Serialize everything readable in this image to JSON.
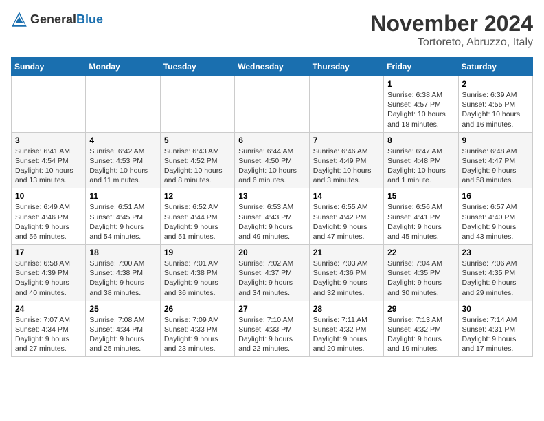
{
  "header": {
    "logo_general": "General",
    "logo_blue": "Blue",
    "month": "November 2024",
    "location": "Tortoreto, Abruzzo, Italy"
  },
  "weekdays": [
    "Sunday",
    "Monday",
    "Tuesday",
    "Wednesday",
    "Thursday",
    "Friday",
    "Saturday"
  ],
  "weeks": [
    [
      {
        "day": "",
        "sunrise": "",
        "sunset": "",
        "daylight": ""
      },
      {
        "day": "",
        "sunrise": "",
        "sunset": "",
        "daylight": ""
      },
      {
        "day": "",
        "sunrise": "",
        "sunset": "",
        "daylight": ""
      },
      {
        "day": "",
        "sunrise": "",
        "sunset": "",
        "daylight": ""
      },
      {
        "day": "",
        "sunrise": "",
        "sunset": "",
        "daylight": ""
      },
      {
        "day": "1",
        "sunrise": "Sunrise: 6:38 AM",
        "sunset": "Sunset: 4:57 PM",
        "daylight": "Daylight: 10 hours and 18 minutes."
      },
      {
        "day": "2",
        "sunrise": "Sunrise: 6:39 AM",
        "sunset": "Sunset: 4:55 PM",
        "daylight": "Daylight: 10 hours and 16 minutes."
      }
    ],
    [
      {
        "day": "3",
        "sunrise": "Sunrise: 6:41 AM",
        "sunset": "Sunset: 4:54 PM",
        "daylight": "Daylight: 10 hours and 13 minutes."
      },
      {
        "day": "4",
        "sunrise": "Sunrise: 6:42 AM",
        "sunset": "Sunset: 4:53 PM",
        "daylight": "Daylight: 10 hours and 11 minutes."
      },
      {
        "day": "5",
        "sunrise": "Sunrise: 6:43 AM",
        "sunset": "Sunset: 4:52 PM",
        "daylight": "Daylight: 10 hours and 8 minutes."
      },
      {
        "day": "6",
        "sunrise": "Sunrise: 6:44 AM",
        "sunset": "Sunset: 4:50 PM",
        "daylight": "Daylight: 10 hours and 6 minutes."
      },
      {
        "day": "7",
        "sunrise": "Sunrise: 6:46 AM",
        "sunset": "Sunset: 4:49 PM",
        "daylight": "Daylight: 10 hours and 3 minutes."
      },
      {
        "day": "8",
        "sunrise": "Sunrise: 6:47 AM",
        "sunset": "Sunset: 4:48 PM",
        "daylight": "Daylight: 10 hours and 1 minute."
      },
      {
        "day": "9",
        "sunrise": "Sunrise: 6:48 AM",
        "sunset": "Sunset: 4:47 PM",
        "daylight": "Daylight: 9 hours and 58 minutes."
      }
    ],
    [
      {
        "day": "10",
        "sunrise": "Sunrise: 6:49 AM",
        "sunset": "Sunset: 4:46 PM",
        "daylight": "Daylight: 9 hours and 56 minutes."
      },
      {
        "day": "11",
        "sunrise": "Sunrise: 6:51 AM",
        "sunset": "Sunset: 4:45 PM",
        "daylight": "Daylight: 9 hours and 54 minutes."
      },
      {
        "day": "12",
        "sunrise": "Sunrise: 6:52 AM",
        "sunset": "Sunset: 4:44 PM",
        "daylight": "Daylight: 9 hours and 51 minutes."
      },
      {
        "day": "13",
        "sunrise": "Sunrise: 6:53 AM",
        "sunset": "Sunset: 4:43 PM",
        "daylight": "Daylight: 9 hours and 49 minutes."
      },
      {
        "day": "14",
        "sunrise": "Sunrise: 6:55 AM",
        "sunset": "Sunset: 4:42 PM",
        "daylight": "Daylight: 9 hours and 47 minutes."
      },
      {
        "day": "15",
        "sunrise": "Sunrise: 6:56 AM",
        "sunset": "Sunset: 4:41 PM",
        "daylight": "Daylight: 9 hours and 45 minutes."
      },
      {
        "day": "16",
        "sunrise": "Sunrise: 6:57 AM",
        "sunset": "Sunset: 4:40 PM",
        "daylight": "Daylight: 9 hours and 43 minutes."
      }
    ],
    [
      {
        "day": "17",
        "sunrise": "Sunrise: 6:58 AM",
        "sunset": "Sunset: 4:39 PM",
        "daylight": "Daylight: 9 hours and 40 minutes."
      },
      {
        "day": "18",
        "sunrise": "Sunrise: 7:00 AM",
        "sunset": "Sunset: 4:38 PM",
        "daylight": "Daylight: 9 hours and 38 minutes."
      },
      {
        "day": "19",
        "sunrise": "Sunrise: 7:01 AM",
        "sunset": "Sunset: 4:38 PM",
        "daylight": "Daylight: 9 hours and 36 minutes."
      },
      {
        "day": "20",
        "sunrise": "Sunrise: 7:02 AM",
        "sunset": "Sunset: 4:37 PM",
        "daylight": "Daylight: 9 hours and 34 minutes."
      },
      {
        "day": "21",
        "sunrise": "Sunrise: 7:03 AM",
        "sunset": "Sunset: 4:36 PM",
        "daylight": "Daylight: 9 hours and 32 minutes."
      },
      {
        "day": "22",
        "sunrise": "Sunrise: 7:04 AM",
        "sunset": "Sunset: 4:35 PM",
        "daylight": "Daylight: 9 hours and 30 minutes."
      },
      {
        "day": "23",
        "sunrise": "Sunrise: 7:06 AM",
        "sunset": "Sunset: 4:35 PM",
        "daylight": "Daylight: 9 hours and 29 minutes."
      }
    ],
    [
      {
        "day": "24",
        "sunrise": "Sunrise: 7:07 AM",
        "sunset": "Sunset: 4:34 PM",
        "daylight": "Daylight: 9 hours and 27 minutes."
      },
      {
        "day": "25",
        "sunrise": "Sunrise: 7:08 AM",
        "sunset": "Sunset: 4:34 PM",
        "daylight": "Daylight: 9 hours and 25 minutes."
      },
      {
        "day": "26",
        "sunrise": "Sunrise: 7:09 AM",
        "sunset": "Sunset: 4:33 PM",
        "daylight": "Daylight: 9 hours and 23 minutes."
      },
      {
        "day": "27",
        "sunrise": "Sunrise: 7:10 AM",
        "sunset": "Sunset: 4:33 PM",
        "daylight": "Daylight: 9 hours and 22 minutes."
      },
      {
        "day": "28",
        "sunrise": "Sunrise: 7:11 AM",
        "sunset": "Sunset: 4:32 PM",
        "daylight": "Daylight: 9 hours and 20 minutes."
      },
      {
        "day": "29",
        "sunrise": "Sunrise: 7:13 AM",
        "sunset": "Sunset: 4:32 PM",
        "daylight": "Daylight: 9 hours and 19 minutes."
      },
      {
        "day": "30",
        "sunrise": "Sunrise: 7:14 AM",
        "sunset": "Sunset: 4:31 PM",
        "daylight": "Daylight: 9 hours and 17 minutes."
      }
    ]
  ]
}
